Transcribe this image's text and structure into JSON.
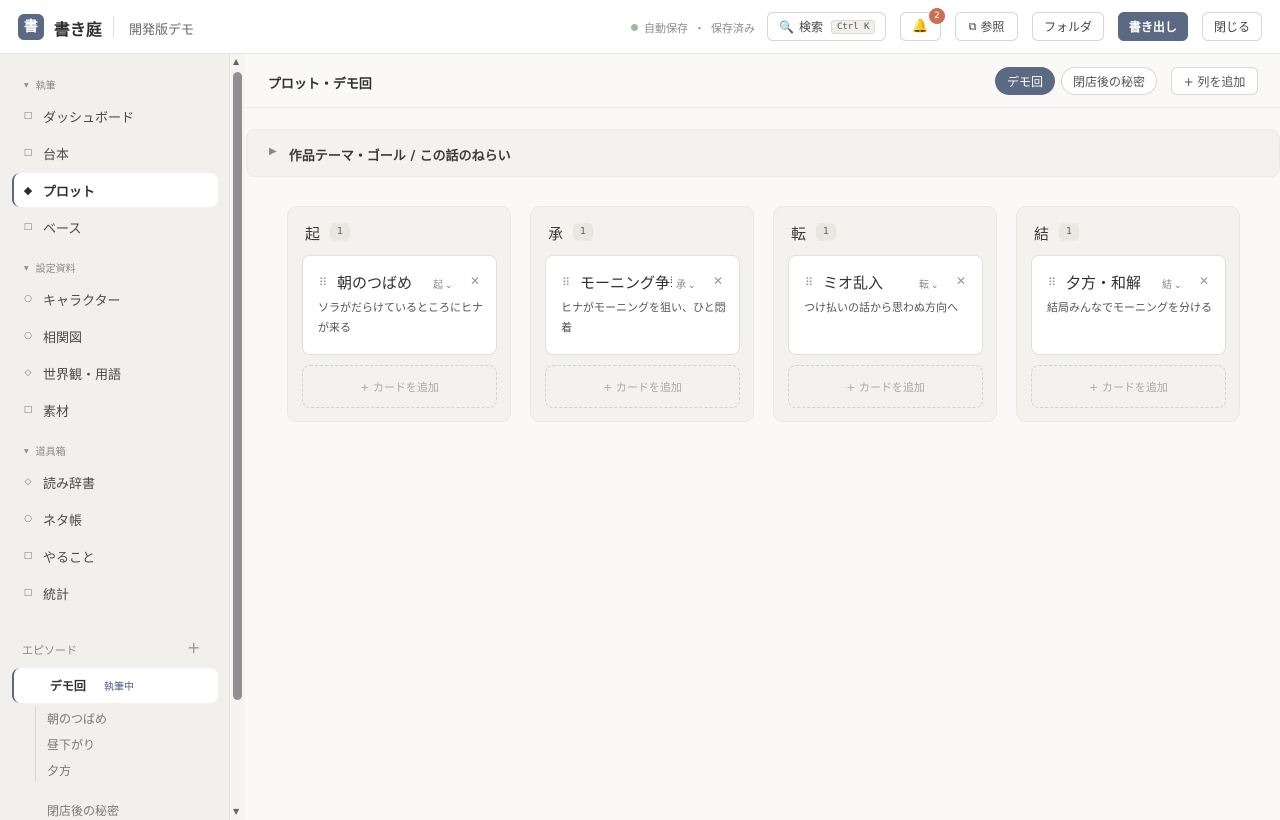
{
  "header": {
    "logo_glyph": "書",
    "app_title": "書き庭",
    "project_name": "開発版デモ",
    "autosave": "自動保存",
    "autosave_sep": "・",
    "save_status": "保存済み",
    "search_label": "検索",
    "search_shortcut": "Ctrl K",
    "notification_count": "2",
    "ref_label": "参照",
    "folder_label": "フォルダ",
    "export_label": "書き出し",
    "close_label": "閉じる"
  },
  "sidebar": {
    "sections": [
      {
        "label": "執筆"
      },
      {
        "label": "設定資料"
      },
      {
        "label": "道具箱"
      }
    ],
    "items": [
      {
        "label": "ダッシュボード",
        "icon": "square-icon"
      },
      {
        "label": "台本",
        "icon": "square-icon"
      },
      {
        "label": "プロット",
        "icon": "diamond-filled-icon"
      },
      {
        "label": "ベース",
        "icon": "square-icon"
      },
      {
        "label": "キャラクター",
        "icon": "circle-icon"
      },
      {
        "label": "相関図",
        "icon": "circle-icon"
      },
      {
        "label": "世界観・用語",
        "icon": "diamond-icon"
      },
      {
        "label": "素材",
        "icon": "square-icon"
      },
      {
        "label": "読み辞書",
        "icon": "diamond-icon"
      },
      {
        "label": "ネタ帳",
        "icon": "circle-icon"
      },
      {
        "label": "やること",
        "icon": "square-icon"
      },
      {
        "label": "統計",
        "icon": "square-icon"
      }
    ],
    "episodes_label": "エピソード",
    "episode_add": "+",
    "active_episode": {
      "title": "デモ回",
      "status": "執筆中"
    },
    "sub_items": [
      "朝のつばめ",
      "昼下がり",
      "夕方"
    ],
    "next_episode": "閉店後の秘密"
  },
  "main": {
    "page_title": "プロット・デモ回",
    "episode_tabs": [
      "デモ回",
      "閉店後の秘密"
    ],
    "add_column_label": "+ 列を追加",
    "theme_label": "作品テーマ・ゴール / この話のねらい",
    "add_card_label": "+ カードを追加",
    "columns": [
      {
        "name": "起",
        "count": "1",
        "card": {
          "title": "朝のつばめ",
          "tag": "起",
          "body": "ソラがだらけているところにヒナが来る"
        }
      },
      {
        "name": "承",
        "count": "1",
        "card": {
          "title": "モーニング争奪",
          "tag": "承",
          "body": "ヒナがモーニングを狙い、ひと悶着"
        }
      },
      {
        "name": "転",
        "count": "1",
        "card": {
          "title": "ミオ乱入",
          "tag": "転",
          "body": "つけ払いの話から思わぬ方向へ"
        }
      },
      {
        "name": "結",
        "count": "1",
        "card": {
          "title": "夕方・和解",
          "tag": "結",
          "body": "結局みんなでモーニングを分ける"
        }
      }
    ]
  },
  "colors": {
    "accent": "#5b6983",
    "badge": "#c96f58",
    "autosave_dot": "#9fb89a"
  }
}
